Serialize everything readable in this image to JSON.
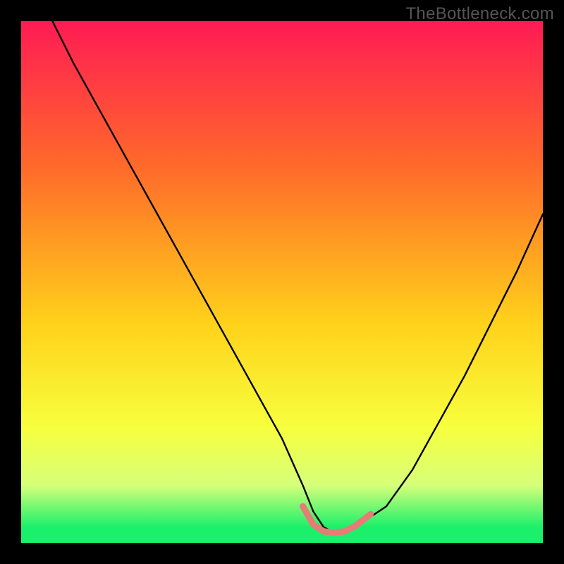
{
  "watermark": "TheBottleneck.com",
  "colors": {
    "bg": "#000000",
    "curve": "#000000",
    "highlight": "#e77b76",
    "grad_top": "#ff1b54",
    "grad_mid1": "#ff6a2a",
    "grad_mid2": "#ffd21a",
    "grad_mid3": "#f7ff3e",
    "grad_bottom_glow": "#d6ff7a",
    "grad_green": "#1bf06a"
  },
  "chart_data": {
    "type": "line",
    "title": "",
    "xlabel": "",
    "ylabel": "",
    "xlim": [
      0,
      100
    ],
    "ylim": [
      0,
      100
    ],
    "grid": false,
    "legend": false,
    "annotations": [],
    "series": [
      {
        "name": "bottleneck-curve",
        "x": [
          6,
          10,
          15,
          20,
          25,
          30,
          35,
          40,
          45,
          50,
          54,
          56,
          58,
          60,
          62,
          64,
          70,
          75,
          80,
          85,
          90,
          95,
          100
        ],
        "y": [
          100,
          92,
          83,
          74,
          65,
          56,
          47,
          38,
          29,
          20,
          11,
          6,
          3,
          2,
          2,
          3,
          7,
          14,
          23,
          32,
          42,
          52,
          63
        ]
      },
      {
        "name": "optimal-range",
        "x": [
          54,
          56,
          58,
          60,
          62,
          64,
          67
        ],
        "y": [
          7,
          3.5,
          2.2,
          2,
          2.2,
          3.2,
          5.5
        ]
      }
    ],
    "background_gradient_stops": [
      {
        "pos": 0.0,
        "color": "#ff1b54"
      },
      {
        "pos": 0.28,
        "color": "#ff6a2a"
      },
      {
        "pos": 0.58,
        "color": "#ffd21a"
      },
      {
        "pos": 0.78,
        "color": "#f7ff3e"
      },
      {
        "pos": 0.89,
        "color": "#d6ff7a"
      },
      {
        "pos": 0.97,
        "color": "#1bf06a"
      },
      {
        "pos": 1.0,
        "color": "#1bf06a"
      }
    ]
  }
}
